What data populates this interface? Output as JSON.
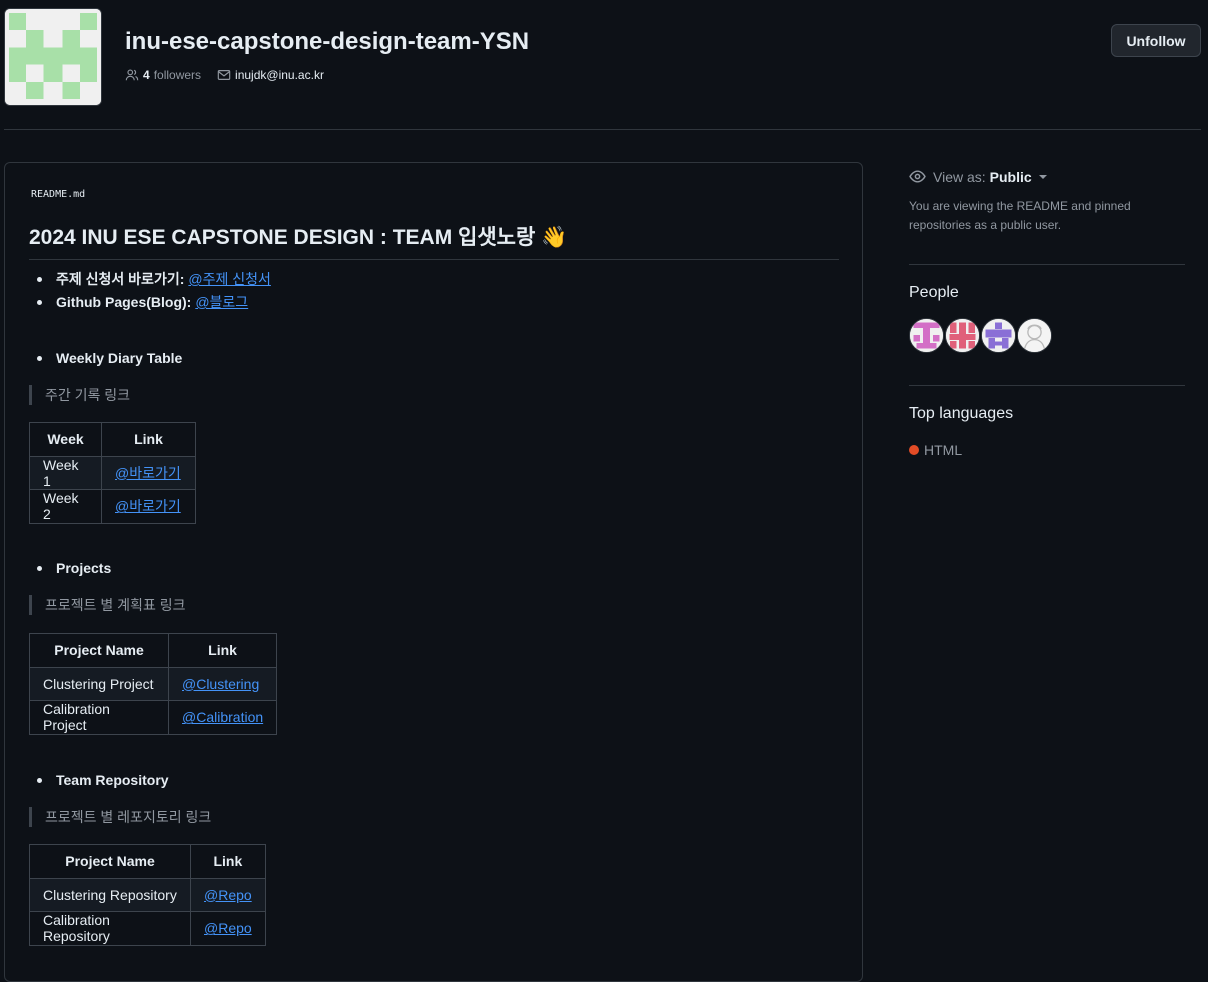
{
  "org": {
    "name": "inu-ese-capstone-design-team-YSN",
    "followers_count": "4",
    "followers_label": "followers",
    "email": "inujdk@inu.ac.kr",
    "unfollow_label": "Unfollow"
  },
  "readme": {
    "label": "README.md",
    "title": "2024 INU ESE CAPSTONE DESIGN : TEAM 입샛노랑 👋",
    "topic_label": "주제 신청서 바로가기:",
    "topic_link": "@주제 신청서",
    "pages_label": "Github Pages(Blog):",
    "pages_link": "@블로그",
    "diary": {
      "heading": "Weekly Diary Table",
      "quote": "주간 기록 링크",
      "headers": [
        "Week",
        "Link"
      ],
      "rows": [
        [
          "Week 1",
          "@바로가기"
        ],
        [
          "Week 2",
          "@바로가기"
        ]
      ]
    },
    "projects": {
      "heading": "Projects",
      "quote": "프로젝트 별 계획표 링크",
      "headers": [
        "Project Name",
        "Link"
      ],
      "rows": [
        [
          "Clustering Project",
          "@Clustering"
        ],
        [
          "Calibration Project",
          "@Calibration"
        ]
      ]
    },
    "repos": {
      "heading": "Team Repository",
      "quote": "프로젝트 별 레포지토리 링크",
      "headers": [
        "Project Name",
        "Link"
      ],
      "rows": [
        [
          "Clustering Repository",
          "@Repo"
        ],
        [
          "Calibration Repository",
          "@Repo"
        ]
      ]
    }
  },
  "sidebar": {
    "view_as_label": "View as:",
    "view_as_value": "Public",
    "view_note": "You are viewing the README and pinned repositories as a public user.",
    "people_heading": "People",
    "languages_heading": "Top languages",
    "languages": [
      {
        "name": "HTML",
        "color": "#e34c26"
      }
    ]
  },
  "colors": {
    "background": "#0d1117",
    "link": "#4493f8",
    "border": "#30363d"
  }
}
